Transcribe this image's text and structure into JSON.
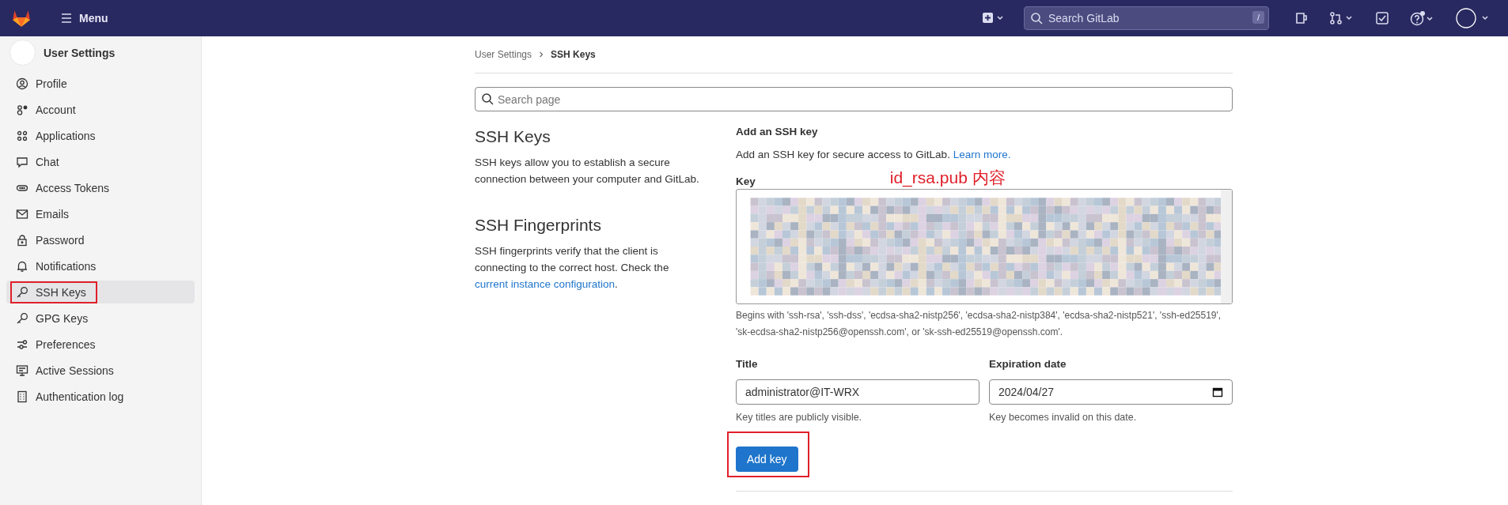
{
  "top_bar": {
    "menu_label": "Menu",
    "search": {
      "placeholder": "Search GitLab",
      "shortcut": "/"
    }
  },
  "sidebar": {
    "title": "User Settings",
    "items": [
      {
        "label": "Profile",
        "selected": false,
        "annotated": false
      },
      {
        "label": "Account",
        "selected": false,
        "annotated": false
      },
      {
        "label": "Applications",
        "selected": false,
        "annotated": false
      },
      {
        "label": "Chat",
        "selected": false,
        "annotated": false
      },
      {
        "label": "Access Tokens",
        "selected": false,
        "annotated": false
      },
      {
        "label": "Emails",
        "selected": false,
        "annotated": false
      },
      {
        "label": "Password",
        "selected": false,
        "annotated": false
      },
      {
        "label": "Notifications",
        "selected": false,
        "annotated": false
      },
      {
        "label": "SSH Keys",
        "selected": true,
        "annotated": true
      },
      {
        "label": "GPG Keys",
        "selected": false,
        "annotated": false
      },
      {
        "label": "Preferences",
        "selected": false,
        "annotated": false
      },
      {
        "label": "Active Sessions",
        "selected": false,
        "annotated": false
      },
      {
        "label": "Authentication log",
        "selected": false,
        "annotated": false
      }
    ]
  },
  "breadcrumb": [
    "User Settings",
    "SSH Keys"
  ],
  "search_page": {
    "placeholder": "Search page"
  },
  "info": [
    {
      "heading": "SSH Keys",
      "text": "SSH keys allow you to establish a secure connection between your computer and GitLab."
    },
    {
      "heading": "SSH Fingerprints",
      "text": "SSH fingerprints verify that the client is connecting to the correct host. Check the",
      "link": "current instance configuration",
      "after": "."
    }
  ],
  "form": {
    "title": "Add an SSH key",
    "intro": "Add an SSH key for secure access to GitLab.",
    "intro_link": "Learn more.",
    "key_label": "Key",
    "annotation": "id_rsa.pub 内容",
    "key_help": "Begins with 'ssh-rsa', 'ssh-dss', 'ecdsa-sha2-nistp256', 'ecdsa-sha2-nistp384', 'ecdsa-sha2-nistp521', 'ssh-ed25519', 'sk-ecdsa-sha2-nistp256@openssh.com', or 'sk-ssh-ed25519@openssh.com'.",
    "title_label": "Title",
    "title_value": "administrator@IT-WRX",
    "title_help": "Key titles are publicly visible.",
    "expiry_label": "Expiration date",
    "expiry_value": "2024/04/27",
    "expiry_help": "Key becomes invalid on this date.",
    "submit": {
      "label": "Add key",
      "annotated": true
    }
  }
}
